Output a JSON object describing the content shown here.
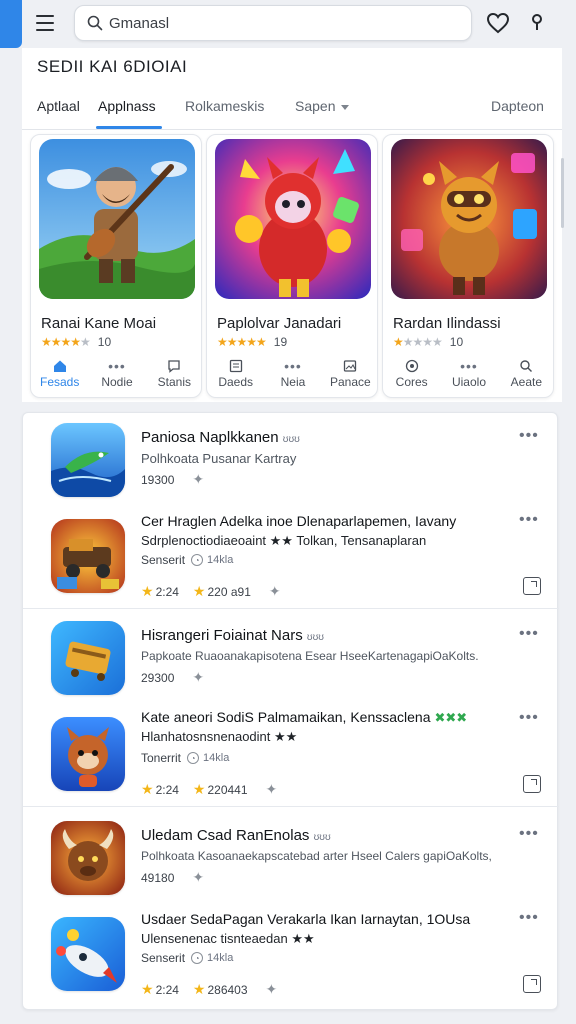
{
  "search": {
    "placeholder": "Gmanasl"
  },
  "section_title": "SEDII KAI 6DIOIAI",
  "tabs": [
    {
      "label": "Aptlaal"
    },
    {
      "label": "Applnass"
    },
    {
      "label": "Rolkameskis"
    },
    {
      "label": "Sapen"
    },
    {
      "label": "Dapteon"
    }
  ],
  "featured": [
    {
      "title": "Ranai Kane Moai",
      "rating": 4,
      "count": "10",
      "actions": [
        "Fesads",
        "Nodie",
        "Stanis"
      ]
    },
    {
      "title": "Paplolvar Janadari",
      "rating": 5,
      "count": "19",
      "actions": [
        "Daeds",
        "Neia",
        "Panace"
      ]
    },
    {
      "title": "Rardan Ilindassi",
      "rating": 1,
      "count": "10",
      "actions": [
        "Cores",
        "Uiaolo",
        "Aeate"
      ]
    }
  ],
  "list": [
    {
      "name": "Paniosa Naplkkanen",
      "suffix": "ʊʊʊ",
      "sub": "Polhkoata Pusanar Kartray",
      "meta": "19300"
    },
    {
      "name": "Cer Hraglen Adelka  inoe Dlenaparlapemen, Iavany",
      "sub": "Sdrplenoctiodiaeoaint ★★ Tolkan, Tensanaplaran",
      "meta": "Senserit",
      "badge": "14kla",
      "stars_a": "2:24",
      "stars_b": "220 a91"
    },
    {
      "name": "Hisrangeri Foiainat Nars",
      "suffix": "ʊʊʊ",
      "sub": "Papkoate Ruaoanakapisotena Esear HseeKartenagapiOaKolts.",
      "meta": "29300"
    },
    {
      "name": "Kate aneori SodiS Palmamaikan, Kenssaclena",
      "green": "✖✖✖",
      "sub": "Hlanhatosnsnenaodint ★★",
      "meta": "Tonerrit",
      "badge": "14kla",
      "stars_a": "2:24",
      "stars_b": "220441"
    },
    {
      "name": "Uledam Csad RanEnolas",
      "suffix": "ʊʊʊ",
      "sub": "Polhkoata Kasoanaekapscatebad arter Hseel Calers gapiOaKolts,",
      "meta": "49180"
    },
    {
      "name": "Usdaer SedaPagan Verakarla  Ikan Iarnaytan, 1OUsa",
      "sub": "Ulensenenac tisnteaedan ★★",
      "meta": "Senserit",
      "badge": "14kla",
      "stars_a": "2:24",
      "stars_b": "286403"
    }
  ],
  "colors": {
    "accent": "#2f86e8",
    "star": "#f3a51b",
    "green_star": "#2fa84f"
  }
}
